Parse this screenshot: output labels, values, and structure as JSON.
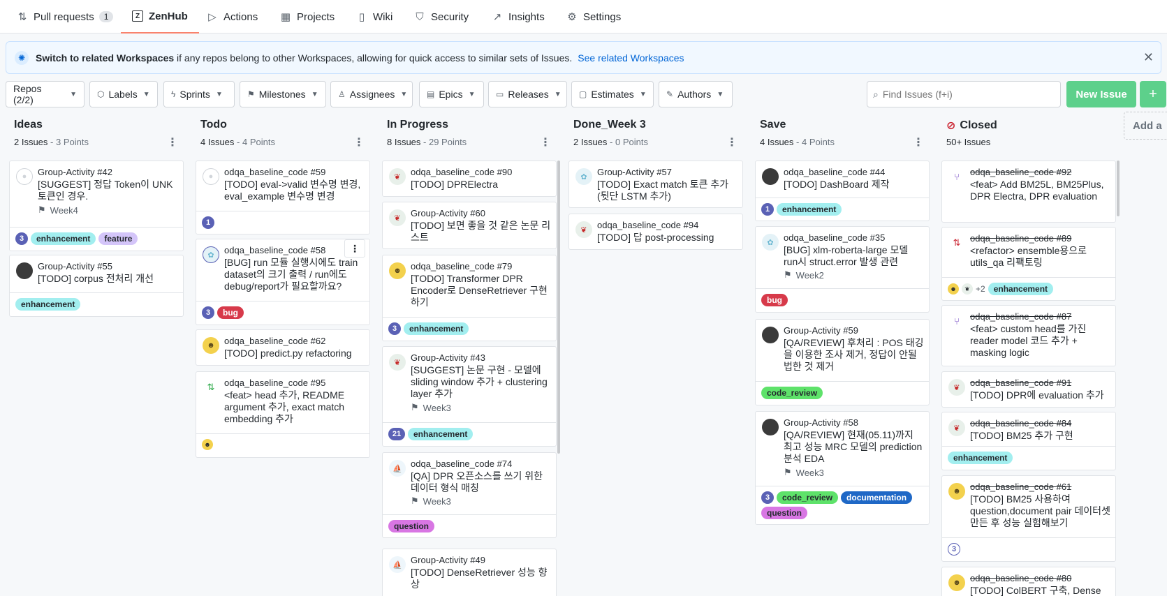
{
  "nav": {
    "tabs": [
      {
        "label": "Pull requests",
        "count": "1"
      },
      {
        "label": "ZenHub"
      },
      {
        "label": "Actions"
      },
      {
        "label": "Projects"
      },
      {
        "label": "Wiki"
      },
      {
        "label": "Security"
      },
      {
        "label": "Insights"
      },
      {
        "label": "Settings"
      }
    ]
  },
  "banner": {
    "bold": "Switch to related Workspaces",
    "text": "if any repos belong to other Workspaces, allowing for quick access to similar sets of Issues.",
    "link": "See related Workspaces"
  },
  "filters": [
    "Repos (2/2)",
    "Labels",
    "Sprints",
    "Milestones",
    "Assignees",
    "Epics",
    "Releases",
    "Estimates",
    "Authors"
  ],
  "search": {
    "placeholder": "Find Issues (f+i)"
  },
  "new_issue": "New Issue",
  "add_column": "Add a",
  "columns": [
    {
      "name": "Ideas",
      "issues": "2 Issues",
      "points": " - 3 Points",
      "cards": [
        {
          "repo": "Group-Activity",
          "num": "#42",
          "title": "[SUGGEST] 정답 Token이 UNK 토큰인 경우.",
          "milestone": "Week4",
          "est": "3",
          "labels": [
            "enhancement",
            "feature"
          ]
        },
        {
          "repo": "Group-Activity",
          "num": "#55",
          "title": "[TODO] corpus 전처리 개선",
          "labels": [
            "enhancement"
          ]
        }
      ]
    },
    {
      "name": "Todo",
      "issues": "4 Issues",
      "points": " - 4 Points",
      "cards": [
        {
          "repo": "odqa_baseline_code",
          "num": "#59",
          "title": "[TODO] eval->valid 변수명 변경, eval_example 변수명 변경",
          "est": "1"
        },
        {
          "repo": "odqa_baseline_code",
          "num": "#58",
          "title": "[BUG] run 모듈 실행시에도 train dataset의 크기 출력 / run에도 debug/report가 필요할까요?",
          "est": "3",
          "labels": [
            "bug"
          ]
        },
        {
          "repo": "odqa_baseline_code",
          "num": "#62",
          "title": "[TODO] predict.py refactoring"
        },
        {
          "repo": "odqa_baseline_code",
          "num": "#95",
          "title": "<feat> head 추가, README argument 추가, exact match embedding 추가"
        }
      ]
    },
    {
      "name": "In Progress",
      "issues": "8 Issues",
      "points": " - 29 Points",
      "cards": [
        {
          "repo": "odqa_baseline_code",
          "num": "#90",
          "title": "[TODO] DPRElectra"
        },
        {
          "repo": "Group-Activity",
          "num": "#60",
          "title": "[TODO] 보면 좋을 것 같은 논문 리스트"
        },
        {
          "repo": "odqa_baseline_code",
          "num": "#79",
          "title": "[TODO] Transformer DPR Encoder로 DenseRetriever 구현하기",
          "est": "3",
          "labels": [
            "enhancement"
          ]
        },
        {
          "repo": "Group-Activity",
          "num": "#43",
          "title": "[SUGGEST] 논문 구현 - 모델에 sliding window 추가 + clustering layer 추가",
          "milestone": "Week3",
          "est": "21",
          "labels": [
            "enhancement"
          ]
        },
        {
          "repo": "odqa_baseline_code",
          "num": "#74",
          "title": "[QA] DPR 오픈소스를 쓰기 위한 데이터 형식 매칭",
          "milestone": "Week3",
          "labels": [
            "question"
          ]
        },
        {
          "repo": "Group-Activity",
          "num": "#49",
          "title": "[TODO] DenseRetriever 성능 향상"
        }
      ]
    },
    {
      "name": "Done_Week 3",
      "issues": "2 Issues",
      "points": " - 0 Points",
      "cards": [
        {
          "repo": "Group-Activity",
          "num": "#57",
          "title": "[TODO] Exact match 토큰 추가 (뒷단 LSTM 추가)"
        },
        {
          "repo": "odqa_baseline_code",
          "num": "#94",
          "title": "[TODO] 답 post-processing"
        }
      ]
    },
    {
      "name": "Save",
      "issues": "4 Issues",
      "points": " - 4 Points",
      "cards": [
        {
          "repo": "odqa_baseline_code",
          "num": "#44",
          "title": "[TODO] DashBoard 제작",
          "est": "1",
          "labels": [
            "enhancement"
          ]
        },
        {
          "repo": "odqa_baseline_code",
          "num": "#35",
          "title": "[BUG] xlm-roberta-large 모델 run시 struct.error 발생 관련",
          "milestone": "Week2",
          "labels": [
            "bug"
          ]
        },
        {
          "repo": "Group-Activity",
          "num": "#59",
          "title": "[QA/REVIEW] 후처리 : POS 태깅을 이용한 조사 제거, 정답이 안될법한 것 제거",
          "labels": [
            "code_review"
          ]
        },
        {
          "repo": "Group-Activity",
          "num": "#58",
          "title": "[QA/REVIEW] 현재(05.11)까지 최고 성능 MRC 모델의 prediction 분석 EDA",
          "milestone": "Week3",
          "est": "3",
          "labels": [
            "code_review",
            "documentation",
            "question"
          ]
        }
      ]
    },
    {
      "name": "Closed",
      "issues": "50+ Issues",
      "points": "",
      "cards": [
        {
          "repo": "odqa_baseline_code",
          "num": "#92",
          "title": "<feat> Add BM25L, BM25Plus, DPR Electra, DPR evaluation"
        },
        {
          "repo": "odqa_baseline_code",
          "num": "#89",
          "title": "<refactor> ensemble용으로 utils_qa 리팩토링",
          "more": "+2",
          "labels": [
            "enhancement"
          ]
        },
        {
          "repo": "odqa_baseline_code",
          "num": "#87",
          "title": "<feat> custom head를 가진 reader model 코드 추가 + masking logic"
        },
        {
          "repo": "odqa_baseline_code",
          "num": "#91",
          "title": "[TODO] DPR에 evaluation 추가"
        },
        {
          "repo": "odqa_baseline_code",
          "num": "#84",
          "title": "[TODO] BM25 추가 구현",
          "labels": [
            "enhancement"
          ]
        },
        {
          "repo": "odqa_baseline_code",
          "num": "#61",
          "title": "[TODO] BM25 사용하여 question,document pair 데이터셋 만든 후 성능 실험해보기",
          "est": "3"
        },
        {
          "repo": "odqa_baseline_code",
          "num": "#80",
          "title": "[TODO] ColBERT 구축, Dense"
        }
      ]
    }
  ],
  "icons": {
    "tab_pr": "pull-request-icon",
    "tab_zenhub": "zenhub-icon",
    "tab_actions": "play-icon",
    "tab_projects": "project-icon",
    "tab_wiki": "book-icon",
    "tab_security": "shield-icon",
    "tab_insights": "graph-icon",
    "tab_settings": "gear-icon"
  }
}
